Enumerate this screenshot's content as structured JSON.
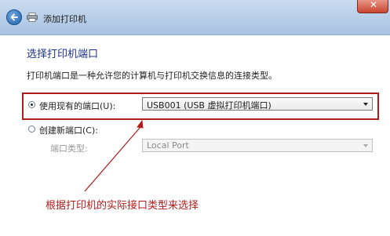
{
  "window": {
    "title": "添加打印机",
    "close_glyph": "✕"
  },
  "page": {
    "heading": "选择打印机端口",
    "description": "打印机端口是一种允许您的计算机与打印机交换信息的连接类型。"
  },
  "existing_port": {
    "label": "使用现有的端口(U):",
    "selected": true,
    "value": "USB001 (USB 虚拟打印机端口)"
  },
  "new_port": {
    "label": "创建新端口(C):",
    "selected": false,
    "type_label": "端口类型:",
    "type_value": "Local Port"
  },
  "annotation": {
    "text": "根据打印机的实际接口类型来选择",
    "color": "#b01c1c"
  }
}
